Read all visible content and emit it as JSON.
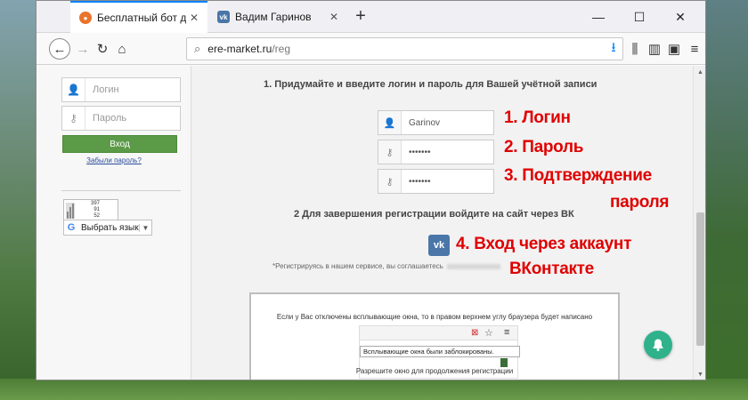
{
  "browser": {
    "tabs": [
      {
        "title": "Бесплатный бот для vktarget a",
        "active": true,
        "favicon": "orange-site-icon"
      },
      {
        "title": "Вадим Гаринов",
        "active": false,
        "favicon": "vk-icon"
      }
    ],
    "url_host": "ere-market.ru",
    "url_path": "/reg"
  },
  "sidebar": {
    "login_placeholder": "Логин",
    "password_placeholder": "Пароль",
    "login_button": "Вход",
    "forgot_link": "Забыли пароль?",
    "counter": [
      "397",
      "91",
      "52"
    ],
    "translate_label": "Выбрать язык"
  },
  "register": {
    "step1_title": "1. Придумайте и введите логин и пароль для Вашей учётной записи",
    "login_value": "Garinov",
    "password_value": "•••••••",
    "confirm_value": "•••••••",
    "step2_title": "2 Для завершения регистрации войдите на сайт через ВК",
    "vk_button": "vk",
    "note": "*Регистрируясь в нашем сервисе, вы соглашаетесь"
  },
  "annotations": {
    "a1": "1. Логин",
    "a2": "2. Пароль",
    "a3_line1": "3. Подтверждение",
    "a3_line2": "пароля",
    "a4_line1": "4. Вход через аккаунт",
    "a4_line2": "ВКонтакте"
  },
  "popup_help": {
    "hint": "Если у Вас отключены всплывающие окна, то в правом верхнем углу браузера будет написано",
    "tooltip": "Всплывающие окна были заблокированы.",
    "caption": "Разрешите окно для продолжения регистрации"
  },
  "colors": {
    "accent": "#0a84ff",
    "login_button": "#5b9a47",
    "annotation": "#e00000",
    "vk": "#4a76a8",
    "bell": "#2fb28b"
  }
}
